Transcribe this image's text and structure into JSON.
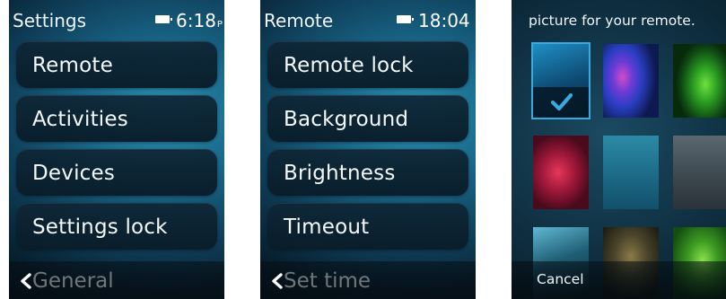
{
  "screens": {
    "settings": {
      "title": "Settings",
      "time": "6:18",
      "ampm": "P",
      "items": [
        {
          "label": "Remote"
        },
        {
          "label": "Activities"
        },
        {
          "label": "Devices"
        },
        {
          "label": "Settings lock"
        }
      ],
      "partial_item": "General",
      "back_icon": "chevron-left-icon"
    },
    "remote": {
      "title": "Remote",
      "time": "18:04",
      "items": [
        {
          "label": "Remote lock"
        },
        {
          "label": "Background"
        },
        {
          "label": "Brightness"
        },
        {
          "label": "Timeout"
        }
      ],
      "partial_item": "Set time",
      "back_icon": "chevron-left-icon"
    },
    "background": {
      "hint": "picture for your remote.",
      "cancel_label": "Cancel",
      "check_icon": "checkmark-icon",
      "selected_tile": 0
    }
  },
  "colors": {
    "accent": "#39a9df",
    "button_bg": "#0e2636",
    "text": "#ffffff"
  }
}
